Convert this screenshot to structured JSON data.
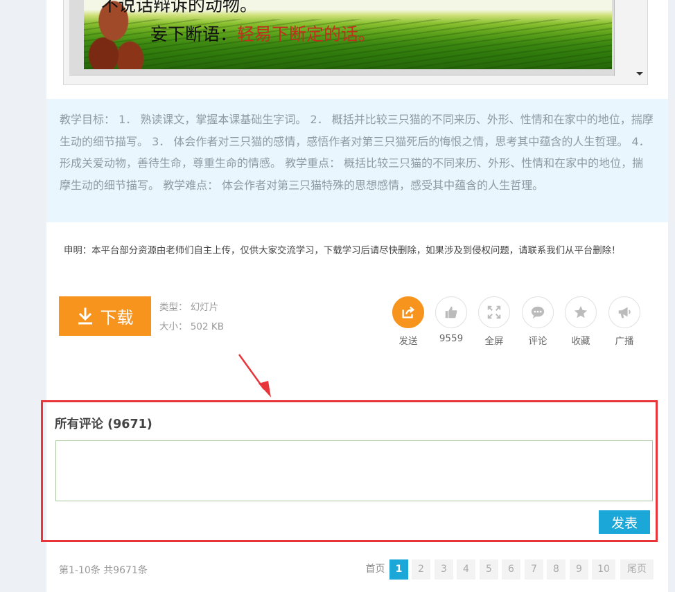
{
  "slide": {
    "line1": "不说话辩诉的动物。",
    "line2_label": "妄下断语：",
    "line2_red": "轻易下断定的话。"
  },
  "objectives": {
    "text": "教学目标： 1． 熟读课文，掌握本课基础生字词。 2． 概括并比较三只猫的不同来历、外形、性情和在家中的地位，揣摩生动的细节描写。 3． 体会作者对三只猫的感情，感悟作者对第三只猫死后的悔恨之情，思考其中蕴含的人生哲理。 4． 形成关爱动物，善待生命，尊重生命的情感。 教学重点： 概括比较三只猫的不同来历、外形、性情和在家中的地位，揣摩生动的细节描写。 教学难点： 体会作者对第三只猫特殊的思想感情，感受其中蕴含的人生哲理。"
  },
  "disclaimer": "申明：本平台部分资源由老师们自主上传，仅供大家交流学习，下载学习后请尽快删除，如果涉及到侵权问题，请联系我们从平台删除！",
  "download": {
    "label": "下载",
    "type_text": "类型： 幻灯片",
    "size_text": "大小： 502 KB"
  },
  "actions": [
    {
      "label": "发送",
      "icon": "share-icon"
    },
    {
      "label": "9559",
      "icon": "thumbs-up-icon"
    },
    {
      "label": "全屏",
      "icon": "fullscreen-icon"
    },
    {
      "label": "评论",
      "icon": "comment-icon"
    },
    {
      "label": "收藏",
      "icon": "star-icon"
    },
    {
      "label": "广播",
      "icon": "megaphone-icon"
    }
  ],
  "comments": {
    "title": "所有评论 (9671)",
    "input_value": "",
    "submit_label": "发表"
  },
  "pagination": {
    "count_text": "第1-10条 共9671条",
    "first_label": "首页",
    "pages": [
      "1",
      "2",
      "3",
      "4",
      "5",
      "6",
      "7",
      "8",
      "9",
      "10"
    ],
    "current": "1",
    "last_label": "尾页"
  },
  "colors": {
    "accent_orange": "#f7941d",
    "accent_blue": "#1ba7d8",
    "highlight_red": "#e8353a",
    "objectives_bg": "#e9f6fe"
  }
}
